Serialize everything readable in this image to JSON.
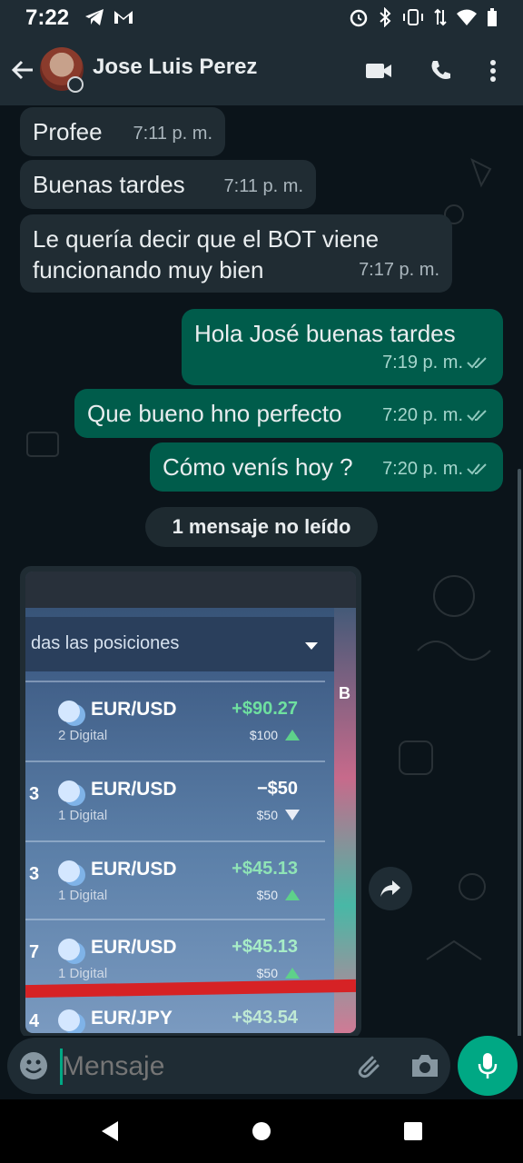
{
  "status_bar": {
    "time": "7:22",
    "icons": [
      "telegram-icon",
      "gmail-icon",
      "alarm-icon",
      "bluetooth-icon",
      "vibrate-icon",
      "data-icon",
      "wifi-icon",
      "battery-icon"
    ]
  },
  "header": {
    "contact_name": "Jose Luis Perez",
    "icons": [
      "back-arrow-icon",
      "video-call-icon",
      "phone-icon",
      "more-vert-icon"
    ]
  },
  "messages": [
    {
      "direction": "in",
      "text": "Profee",
      "time": "7:11 p. m."
    },
    {
      "direction": "in",
      "text": "Buenas tardes",
      "time": "7:11 p. m."
    },
    {
      "direction": "in",
      "text": "Le quería decir que el BOT viene funcionando muy bien",
      "time": "7:17 p. m."
    },
    {
      "direction": "out",
      "text": "Hola José buenas tardes",
      "time": "7:19 p. m."
    },
    {
      "direction": "out",
      "text": "Que bueno hno perfecto",
      "time": "7:20 p. m."
    },
    {
      "direction": "out",
      "text": "Cómo venís hoy ?",
      "time": "7:20 p. m."
    }
  ],
  "unread_label": "1 mensaje no leído",
  "photo": {
    "header_text": "das las posiciones",
    "side_letter": "B",
    "trades": [
      {
        "index": "",
        "pair": "EUR/USD",
        "sub": "2 Digital",
        "value": "+$90.27",
        "bet": "$100",
        "dir": "up"
      },
      {
        "index": "3",
        "pair": "EUR/USD",
        "sub": "1 Digital",
        "value": "−$50",
        "bet": "$50",
        "dir": "down"
      },
      {
        "index": "3",
        "pair": "EUR/USD",
        "sub": "1 Digital",
        "value": "+$45.13",
        "bet": "$50",
        "dir": "up"
      },
      {
        "index": "7",
        "pair": "EUR/USD",
        "sub": "1 Digital",
        "value": "+$45.13",
        "bet": "$50",
        "dir": "up"
      },
      {
        "index": "4",
        "pair": "EUR/JPY",
        "sub": "",
        "value": "+$43.54",
        "bet": "",
        "dir": ""
      }
    ]
  },
  "input": {
    "placeholder": "Mensaje"
  },
  "colors": {
    "bg": "#0b141a",
    "bar": "#1f2c34",
    "incoming": "#202c33",
    "outgoing": "#005c4b",
    "accent": "#00a884"
  }
}
